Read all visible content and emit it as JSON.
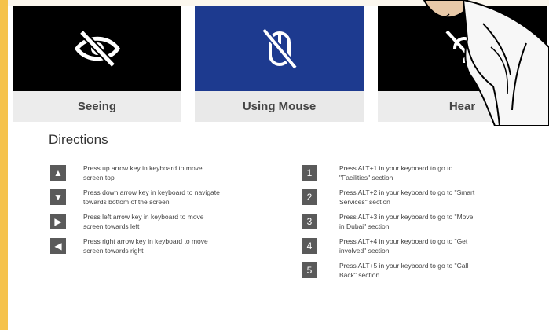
{
  "cards": [
    {
      "label": "Seeing",
      "icon": "eye-slash-icon"
    },
    {
      "label": "Using Mouse",
      "icon": "mouse-slash-icon"
    },
    {
      "label": "Hear",
      "icon": "ear-slash-icon"
    }
  ],
  "directions": {
    "title": "Directions",
    "arrows": [
      {
        "key": "▲",
        "line1": "Press up arrow key in keyboard to move",
        "line2": "screen top"
      },
      {
        "key": "▼",
        "line1": "Press down arrow key in keyboard to navigate",
        "line2": "towards bottom of the screen"
      },
      {
        "key": "▶",
        "line1": "Press left arrow key in keyboard to move",
        "line2": "screen towards left"
      },
      {
        "key": "◀",
        "line1": "Press right arrow key in keyboard to move",
        "line2": "screen towards right"
      }
    ],
    "shortcuts": [
      {
        "key": "1",
        "line1": "Press ALT+1 in your keyboard to go to",
        "line2": "\"Facilities\" section"
      },
      {
        "key": "2",
        "line1": "Press ALT+2 in your keyboard to go to \"Smart",
        "line2": "Services\" section"
      },
      {
        "key": "3",
        "line1": "Press ALT+3 in your keyboard to go to \"Move",
        "line2": "in Dubai\" section"
      },
      {
        "key": "4",
        "line1": "Press ALT+4 in your keyboard to go to \"Get",
        "line2": "involved\" section"
      },
      {
        "key": "5",
        "line1": "Press ALT+5 in your keyboard to go to \"Call",
        "line2": "Back\" section"
      }
    ]
  },
  "colors": {
    "accent": "#f5c24b",
    "active_tile": "#1d3a8f",
    "tile": "#000000",
    "key_bg": "#5a5a5a"
  }
}
